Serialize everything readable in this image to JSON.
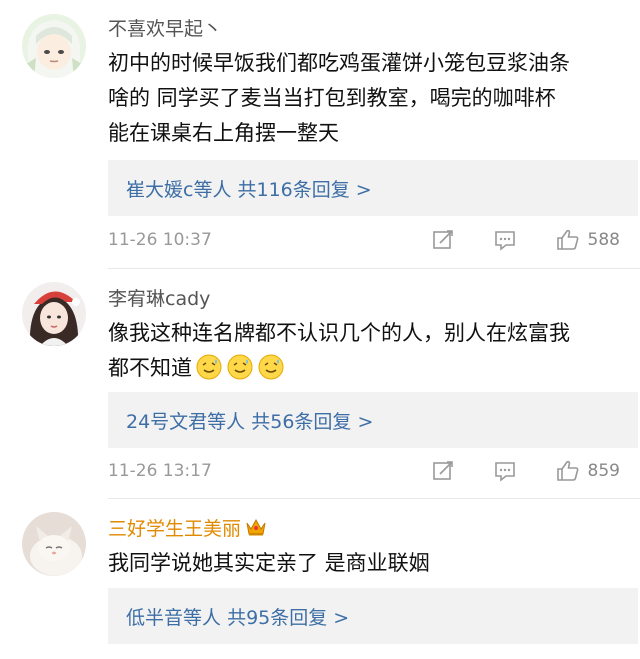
{
  "comments": [
    {
      "username": "不喜欢早起丶",
      "lines": [
        "初中的时候早饭我们都吃鸡蛋灌饼小笼包豆浆油条",
        "啥的 同学买了麦当当打包到教室，喝完的咖啡杯",
        "能在课桌右上角摆一整天"
      ],
      "reply_prefix": "崔大媛c等人",
      "reply_count": "共116条回复 >",
      "time": "11-26 10:37",
      "likes": "588"
    },
    {
      "username": "李宥琳cady",
      "lines": [
        "像我这种连名牌都不认识几个的人，别人在炫富我",
        "都不知道"
      ],
      "emoji": [
        "sweat-smile-emoji",
        "sweat-smile-emoji",
        "sweat-smile-emoji"
      ],
      "reply_prefix": "24号文君等人",
      "reply_count": "共56条回复 >",
      "time": "11-26 13:17",
      "likes": "859"
    },
    {
      "username": "三好学生王美丽",
      "badge": "crown-icon",
      "lines": [
        "我同学说她其实定亲了 是商业联姻"
      ],
      "reply_prefix": "低半音等人",
      "reply_count": "共95条回复 >"
    }
  ],
  "colors": {
    "link": "#3d6fa6",
    "gold_name": "#e08a00",
    "reply_bg": "#f2f2f2",
    "meta": "#999999"
  }
}
